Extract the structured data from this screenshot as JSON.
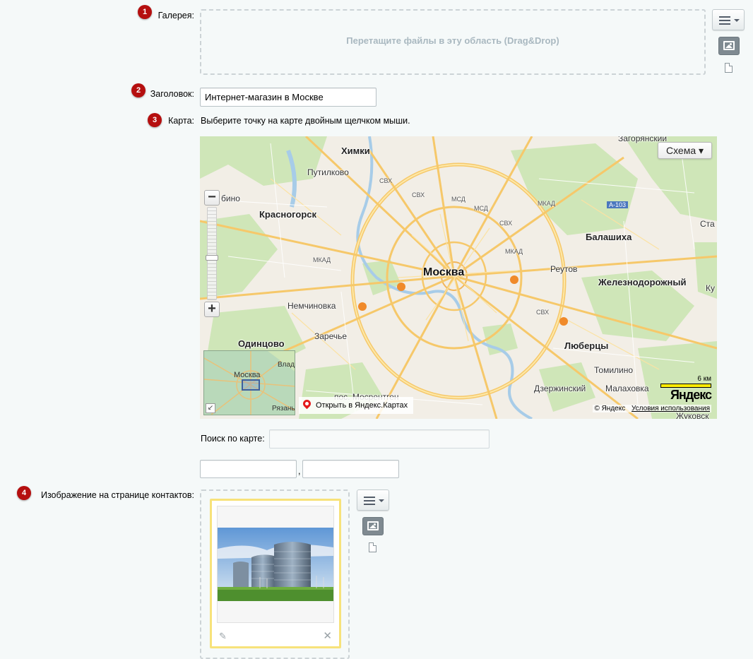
{
  "gallery": {
    "badge": "1",
    "label": "Галерея:",
    "dropzone_text": "Перетащите файлы в эту область (Drag&Drop)",
    "menu_icon": "hamburger-menu-icon",
    "image_icon": "image-icon",
    "file_icon": "file-icon"
  },
  "title_field": {
    "badge": "2",
    "label": "Заголовок:",
    "value": "Интернет-магазин в Москве"
  },
  "map_field": {
    "badge": "3",
    "label": "Карта:",
    "hint": "Выберите точку на карте двойным щелчком мыши.",
    "map": {
      "type_button": "Схема ▾",
      "zoom_in": "+",
      "zoom_out": "−",
      "zoom_level": 0.45,
      "places": {
        "moscow": "Москва",
        "khimki": "Химки",
        "putilkovo": "Путилково",
        "krasnogorsk": "Красногорск",
        "nemchinovka": "Немчиновка",
        "zarechye": "Заречье",
        "odintsovo": "Одинцово",
        "reutov": "Реутов",
        "balashikha": "Балашиха",
        "zheleznodorozhny": "Железнодорожный",
        "lyubertsy": "Люберцы",
        "tomilino": "Томилино",
        "dzerzhinsky": "Дзержинский",
        "malakhovka": "Малаховка",
        "zagoryansky": "Загорянский",
        "zhukovsky": "Жуковск",
        "mosrentgen": "пос. Мосрентген",
        "ku": "Ку",
        "sta": "Ста",
        "bino": "бино"
      },
      "roads": {
        "svh": "СВХ",
        "mkad": "МКАД",
        "msd": "МСД",
        "a103": "А-103"
      },
      "minimap": {
        "moscow": "Москва",
        "vlad": "Влади",
        "ryazan": "Рязань",
        "collapse_icon": "collapse-arrow-icon"
      },
      "open_link": "Открыть в Яндекс.Картах",
      "scale_label": "6 км",
      "logo": "Яндекс",
      "copyright": "© Яндекс",
      "terms": "Условия использования"
    },
    "search_label": "Поиск по карте:",
    "search_value": "",
    "lat_value": "",
    "separator": ",",
    "lon_value": ""
  },
  "contact_image": {
    "badge": "4",
    "label": "Изображение на странице контактов:",
    "edit_icon": "pencil-icon",
    "delete_icon": "close-icon",
    "delete_glyph": "✕",
    "edit_glyph": "✎"
  },
  "colors": {
    "badge": "#b50f0f",
    "page_bg": "#f5f9f9",
    "card_border": "#f7e27a"
  }
}
